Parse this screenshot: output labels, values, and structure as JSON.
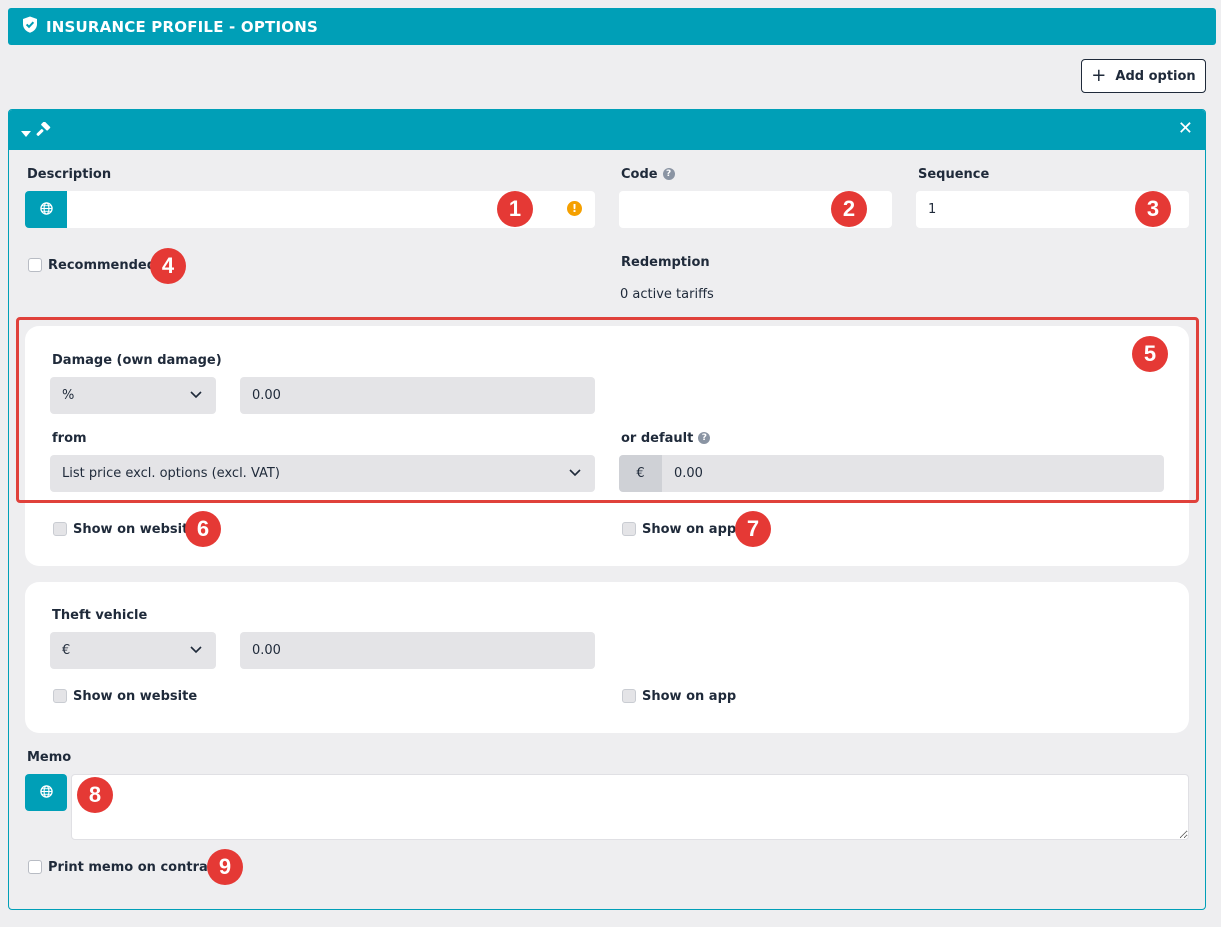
{
  "header": {
    "title": "INSURANCE PROFILE - OPTIONS"
  },
  "toolbar": {
    "add_option_label": "Add option"
  },
  "option": {
    "description_label": "Description",
    "description_value": "",
    "code_label": "Code",
    "code_value": "",
    "sequence_label": "Sequence",
    "sequence_value": "1",
    "recommended_label": "Recommended",
    "recommended_checked": false,
    "redemption_label": "Redemption",
    "redemption_value": "0 active tariffs",
    "memo_label": "Memo",
    "memo_value": "",
    "print_memo_label": "Print memo on contract",
    "print_memo_checked": false
  },
  "damage": {
    "title": "Damage (own damage)",
    "unit": "%",
    "amount": "0.00",
    "from_label": "from",
    "from_value": "List price excl. options (excl. VAT)",
    "default_label": "or default",
    "default_currency": "€",
    "default_value": "0.00",
    "show_website_label": "Show on website",
    "show_app_label": "Show on app"
  },
  "theft": {
    "title": "Theft vehicle",
    "unit": "€",
    "amount": "0.00",
    "show_website_label": "Show on website",
    "show_app_label": "Show on app"
  },
  "badges": [
    "1",
    "2",
    "3",
    "4",
    "5",
    "6",
    "7",
    "8",
    "9"
  ],
  "colors": {
    "accent": "#009fb7",
    "annotation": "#e53935",
    "warning": "#f5a000",
    "background": "#eeeef0"
  },
  "icons": {
    "header": "shield-check-icon",
    "add": "plus-icon",
    "collapse": "caret-down-icon",
    "tool": "hammer-icon",
    "close": "close-icon",
    "language": "globe-icon",
    "warning": "exclamation-icon",
    "help": "question-icon",
    "dropdown": "chevron-down-icon"
  }
}
